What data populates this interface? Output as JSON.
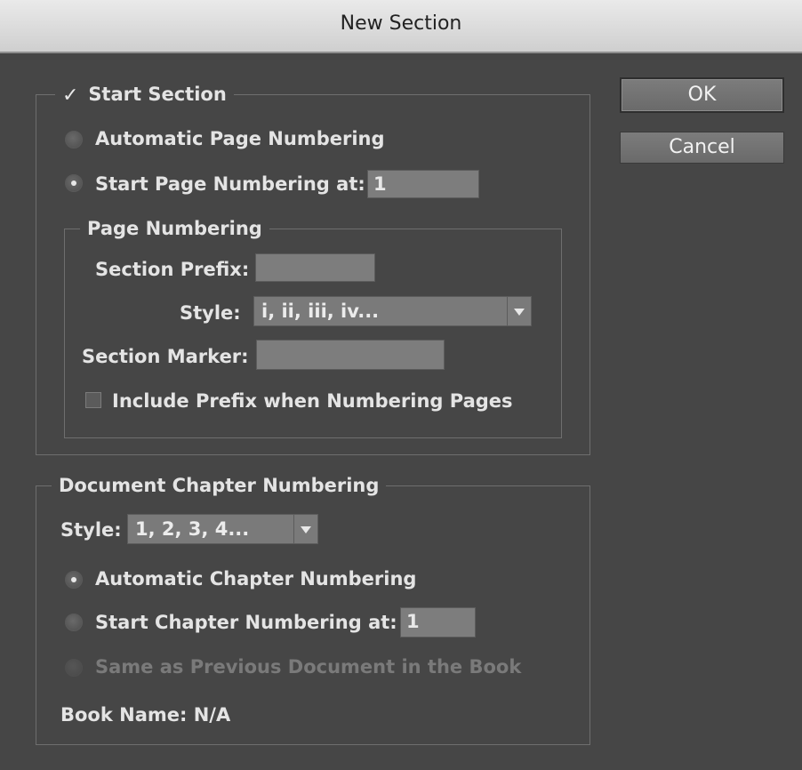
{
  "dialog": {
    "title": "New Section",
    "ok_label": "OK",
    "cancel_label": "Cancel"
  },
  "start_section": {
    "label": "Start Section",
    "checked": true,
    "automatic_page_numbering_label": "Automatic Page Numbering",
    "start_page_numbering_label": "Start Page Numbering at:",
    "start_page_value": "1",
    "selected_option": "start_page_numbering"
  },
  "page_numbering": {
    "legend": "Page Numbering",
    "section_prefix_label": "Section Prefix:",
    "section_prefix_value": "",
    "style_label": "Style:",
    "style_value": "i, ii, iii, iv...",
    "section_marker_label": "Section Marker:",
    "section_marker_value": "",
    "include_prefix_label": "Include Prefix when Numbering Pages",
    "include_prefix_checked": false
  },
  "chapter_numbering": {
    "legend": "Document Chapter Numbering",
    "style_label": "Style:",
    "style_value": "1, 2, 3, 4...",
    "automatic_label": "Automatic Chapter Numbering",
    "start_label": "Start Chapter Numbering at:",
    "start_value": "1",
    "same_as_previous_label": "Same as Previous Document in the Book",
    "book_name_label": "Book Name: N/A",
    "selected_option": "automatic"
  }
}
